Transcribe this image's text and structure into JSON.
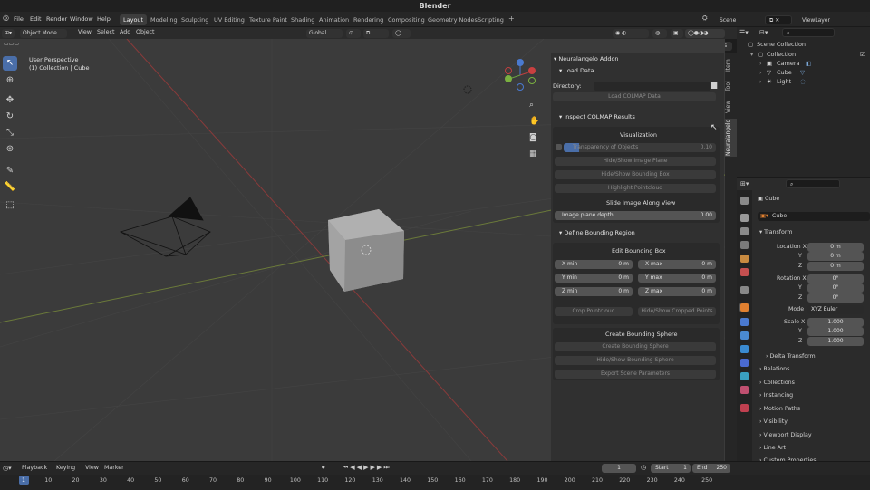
{
  "app": {
    "title": "Blender"
  },
  "menus": [
    "File",
    "Edit",
    "Render",
    "Window",
    "Help"
  ],
  "workspaces": [
    "Layout",
    "Modeling",
    "Sculpting",
    "UV Editing",
    "Texture Paint",
    "Shading",
    "Animation",
    "Rendering",
    "Compositing",
    "Geometry Nodes",
    "Scripting"
  ],
  "active_workspace": "Layout",
  "add_tab": "+",
  "scene": {
    "name": "Scene",
    "view_layer": "ViewLayer"
  },
  "viewport_header": {
    "mode": "Object Mode",
    "menus": [
      "View",
      "Select",
      "Add",
      "Object"
    ],
    "transform": "Global",
    "options": "Options"
  },
  "viewport": {
    "view_name": "User Perspective",
    "collection_info": "(1) Collection | Cube"
  },
  "n_tabs": [
    "Item",
    "Tool",
    "View",
    "Neuralangelo"
  ],
  "addon": {
    "title": "Neuralangelo Addon",
    "load_data": {
      "header": "Load Data",
      "directory_label": "Directory:",
      "load_button": "Load COLMAP Data"
    },
    "inspect": {
      "header": "Inspect COLMAP Results",
      "visualization": {
        "title": "Visualization",
        "transparency_label": "Transparency of Objects",
        "transparency_value": "0.10",
        "transparency_level": 0.1,
        "hide_show_image_plane": "Hide/Show Image Plane",
        "hide_show_bounding_box": "Hide/Show Bounding Box",
        "highlight_pointcloud": "Highlight Pointcloud",
        "slide_label": "Slide Image Along View",
        "image_plane_depth_label": "Image plane depth",
        "image_plane_depth_value": "0.00"
      }
    },
    "bounding": {
      "header": "Define Bounding Region",
      "edit_title": "Edit Bounding Box",
      "x_min": {
        "label": "X min",
        "value": "0 m"
      },
      "x_max": {
        "label": "X max",
        "value": "0 m"
      },
      "y_min": {
        "label": "Y min",
        "value": "0 m"
      },
      "y_max": {
        "label": "Y max",
        "value": "0 m"
      },
      "z_min": {
        "label": "Z min",
        "value": "0 m"
      },
      "z_max": {
        "label": "Z max",
        "value": "0 m"
      },
      "crop_pointcloud": "Crop Pointcloud",
      "hide_show_cropped": "Hide/Show Cropped Points",
      "sphere_title": "Create Bounding Sphere",
      "create_sphere": "Create Bounding Sphere",
      "hide_show_sphere": "Hide/Show Bounding Sphere",
      "export_scene": "Export Scene Parameters"
    }
  },
  "outliner": {
    "root": "Scene Collection",
    "collection": "Collection",
    "items": [
      "Camera",
      "Cube",
      "Light"
    ]
  },
  "properties": {
    "object_name": "Cube",
    "object_field": "Cube",
    "transform_header": "Transform",
    "location_label": "Location X",
    "location": [
      "0 m",
      "0 m",
      "0 m"
    ],
    "rotation_label": "Rotation X",
    "rotation": [
      "0°",
      "0°",
      "0°"
    ],
    "axis_y": "Y",
    "axis_z": "Z",
    "mode_label": "Mode",
    "mode_value": "XYZ Euler",
    "scale_label": "Scale X",
    "scale": [
      "1.000",
      "1.000",
      "1.000"
    ],
    "delta_transform": "Delta Transform",
    "sections": [
      "Relations",
      "Collections",
      "Instancing",
      "Motion Paths",
      "Visibility",
      "Viewport Display",
      "Line Art",
      "Custom Properties"
    ]
  },
  "timeline": {
    "menus": [
      "Playback",
      "Keying",
      "View",
      "Marker"
    ],
    "current_frame": "1",
    "start_label": "Start",
    "start_value": "1",
    "end_label": "End",
    "end_value": "250",
    "ticks": [
      "1",
      "10",
      "20",
      "30",
      "40",
      "50",
      "60",
      "70",
      "80",
      "90",
      "100",
      "110",
      "120",
      "130",
      "140",
      "150",
      "160",
      "170",
      "180",
      "190",
      "200",
      "210",
      "220",
      "230",
      "240",
      "250"
    ]
  }
}
